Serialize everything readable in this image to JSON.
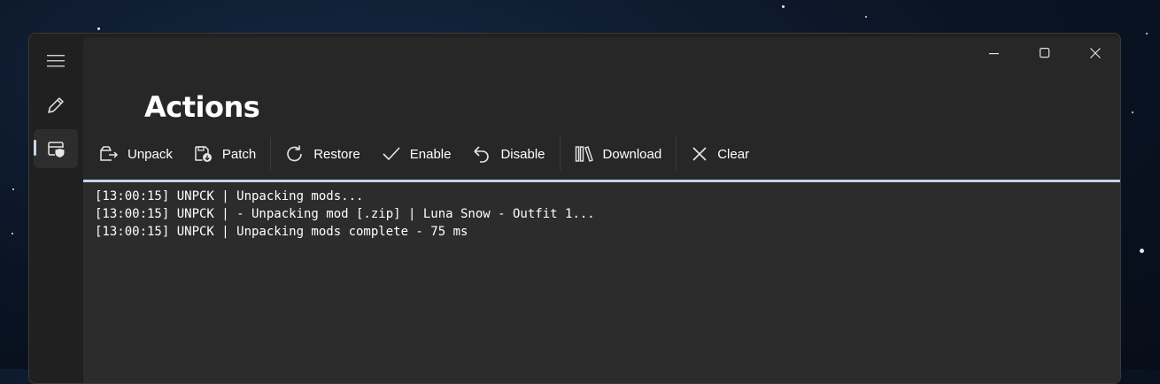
{
  "page": {
    "title": "Actions"
  },
  "nav": {
    "items": [
      {
        "icon": "hamburger-menu-icon"
      },
      {
        "icon": "pencil-icon"
      },
      {
        "icon": "shield-folder-icon",
        "active": true
      }
    ]
  },
  "toolbar": {
    "unpack_label": "Unpack",
    "patch_label": "Patch",
    "restore_label": "Restore",
    "enable_label": "Enable",
    "disable_label": "Disable",
    "download_label": "Download",
    "clear_label": "Clear"
  },
  "log": {
    "lines": [
      "[13:00:15] UNPCK | Unpacking mods...",
      "[13:00:15] UNPCK | - Unpacking mod [.zip] | Luna Snow - Outfit 1...",
      "[13:00:15] UNPCK | Unpacking mods complete - 75 ms"
    ]
  },
  "colors": {
    "accent": "#c4d3ea",
    "window_bg": "#202020",
    "content_bg": "#272727"
  }
}
